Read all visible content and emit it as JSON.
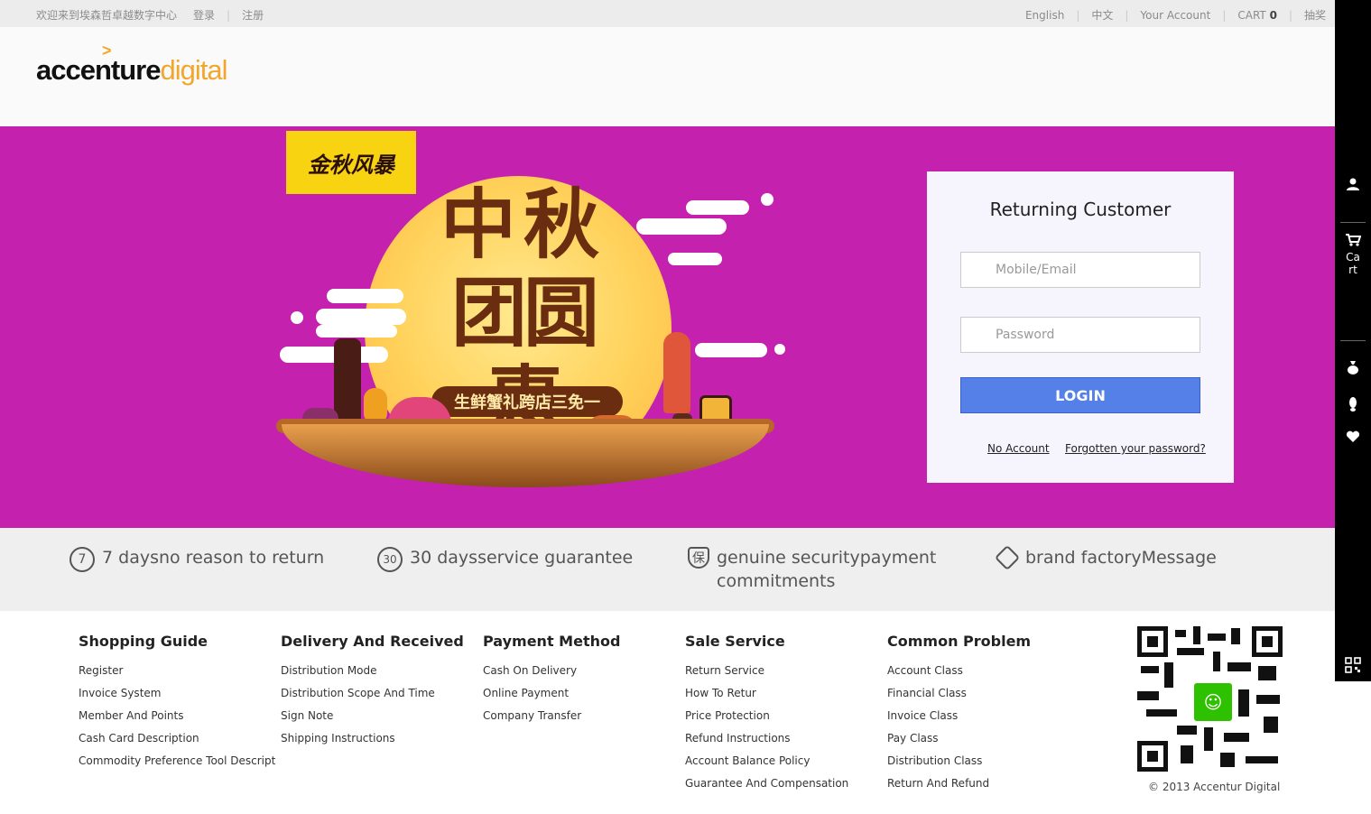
{
  "topbar": {
    "welcome": "欢迎来到埃森哲卓越数字中心",
    "login": "登录",
    "register": "注册",
    "english": "English",
    "chinese": "中文",
    "account": "Your Account",
    "cart_label": "CART",
    "cart_count": "0",
    "lottery": "抽奖"
  },
  "logo": {
    "part1": "accenture",
    "part2": "digital",
    "mark": ">"
  },
  "banner": {
    "tag": "金秋风暴",
    "title_line1": "中秋",
    "title_line2": "团圆惠",
    "subtitle": "生鲜蟹礼跨店三免一"
  },
  "login": {
    "title": "Returning Customer",
    "user_placeholder": "Mobile/Email",
    "password_placeholder": "Password",
    "button": "LOGIN",
    "no_account": "No Account",
    "forgot": "Forgotten your password?"
  },
  "guarantees": [
    {
      "icon": "7",
      "text": "7 daysno reason to return"
    },
    {
      "icon": "30",
      "text": "30 daysservice guarantee"
    },
    {
      "icon": "保",
      "text_line1": "genuine securitypayment",
      "text_line2": "commitments"
    },
    {
      "icon": "tag-icon",
      "text": "brand factoryMessage"
    }
  ],
  "footer": {
    "columns": [
      {
        "title": "Shopping Guide",
        "links": [
          "Register",
          "Invoice System",
          "Member And Points",
          "Cash Card Description",
          "Commodity Preference Tool Descript"
        ]
      },
      {
        "title": "Delivery And Received",
        "links": [
          "Distribution Mode",
          "Distribution Scope And Time",
          "Sign Note",
          "Shipping Instructions"
        ]
      },
      {
        "title": "Payment Method",
        "links": [
          "Cash On Delivery",
          "Online Payment",
          "Company Transfer"
        ]
      },
      {
        "title": "Sale Service",
        "links": [
          "Return Service",
          "How To Retur",
          "Price Protection",
          "Refund Instructions",
          "Account Balance Policy",
          "Guarantee And Compensation"
        ]
      },
      {
        "title": "Common Problem",
        "links": [
          "Account Class",
          "Financial Class",
          "Invoice Class",
          "Pay Class",
          "Distribution Class",
          "Return And Refund"
        ]
      }
    ],
    "copyright": "© 2013 Accentur Digital"
  },
  "sidebar": {
    "cart_label_1": "Ca",
    "cart_label_2": "rt",
    "icons": [
      "user-icon",
      "cart-icon",
      "money-bag-icon",
      "footprint-icon",
      "heart-icon",
      "qr-code-icon"
    ]
  },
  "colors": {
    "banner_bg": "#c521af",
    "login_button": "#5580e8",
    "brand_accent": "#f3a62c",
    "sidebar": "#000000"
  }
}
